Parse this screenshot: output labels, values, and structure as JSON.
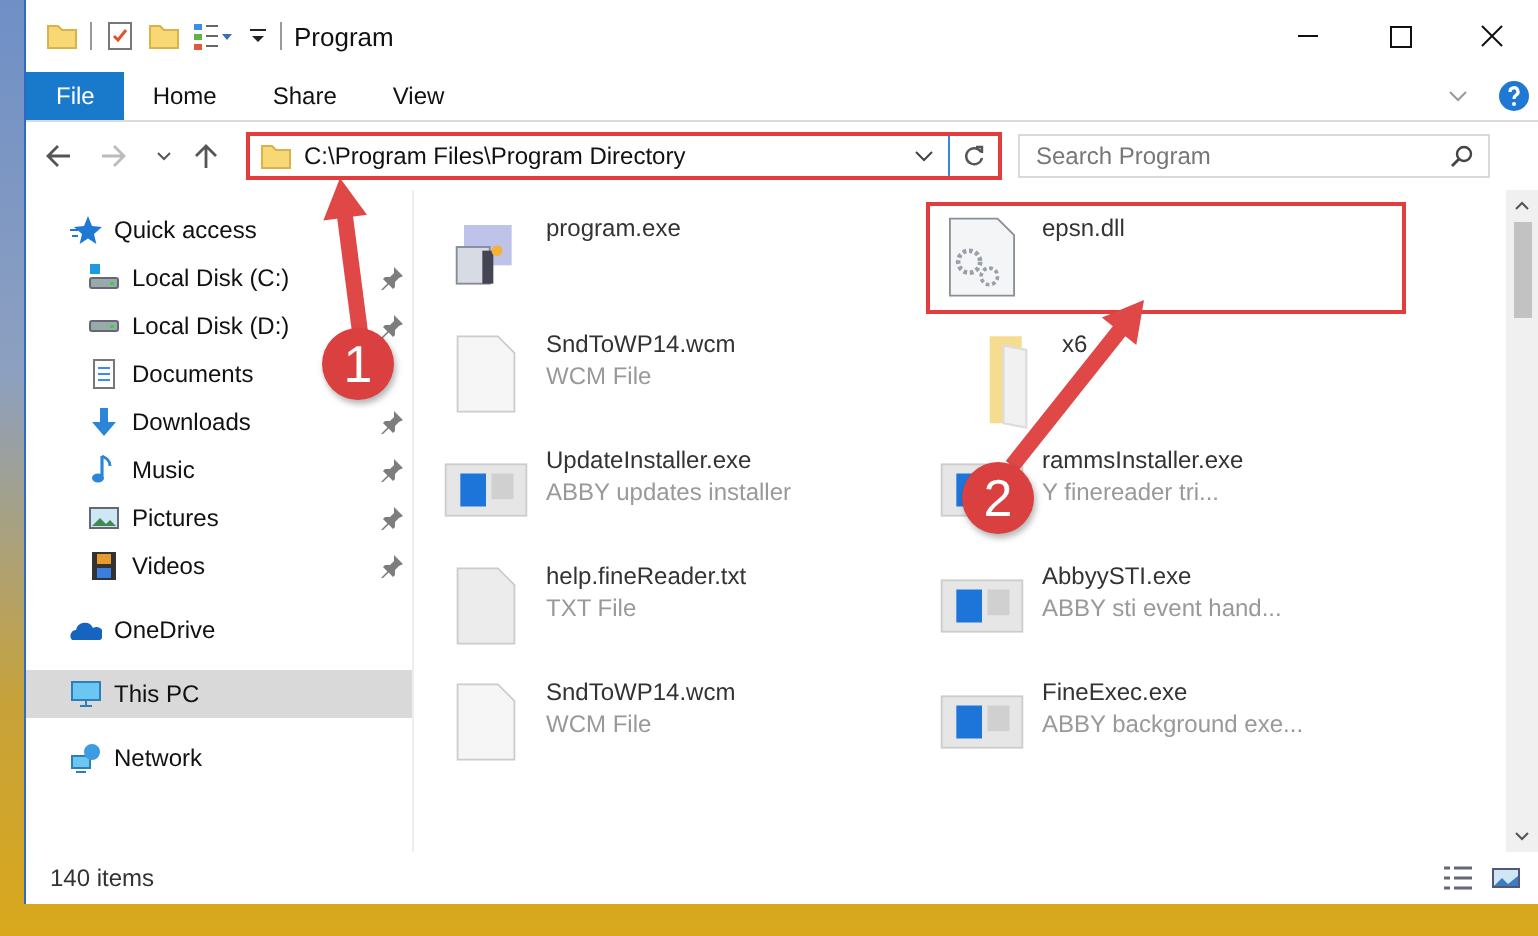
{
  "window": {
    "title": "Program"
  },
  "ribbon": {
    "tabs": [
      {
        "label": "File",
        "kind": "file"
      },
      {
        "label": "Home",
        "kind": "tab"
      },
      {
        "label": "Share",
        "kind": "tab"
      },
      {
        "label": "View",
        "kind": "tab"
      }
    ]
  },
  "address": {
    "path": "C:\\Program Files\\Program Directory",
    "highlighted": true
  },
  "search": {
    "placeholder": "Search Program"
  },
  "sidebar": {
    "items": [
      {
        "label": "Quick access",
        "kind": "quick-access",
        "selected": false,
        "children": [
          {
            "label": "Local Disk (C:)",
            "kind": "drive-c",
            "pinned": true
          },
          {
            "label": "Local Disk (D:)",
            "kind": "drive",
            "pinned": true
          },
          {
            "label": "Documents",
            "kind": "documents",
            "pinned": false
          },
          {
            "label": "Downloads",
            "kind": "downloads",
            "pinned": true
          },
          {
            "label": "Music",
            "kind": "music",
            "pinned": true
          },
          {
            "label": "Pictures",
            "kind": "pictures",
            "pinned": true
          },
          {
            "label": "Videos",
            "kind": "videos",
            "pinned": true
          }
        ]
      },
      {
        "label": "OneDrive",
        "kind": "onedrive",
        "selected": false
      },
      {
        "label": "This PC",
        "kind": "pc",
        "selected": true
      },
      {
        "label": "Network",
        "kind": "network",
        "selected": false
      }
    ]
  },
  "files": [
    {
      "name": "program.exe",
      "kind": "app",
      "highlighted": false
    },
    {
      "name": "epsn.dll",
      "kind": "dll",
      "highlighted": true
    },
    {
      "name": "SndToWP14.wcm",
      "type": "WCM File",
      "kind": "file",
      "highlighted": false
    },
    {
      "name": "x6",
      "kind": "folder",
      "highlighted": false
    },
    {
      "name": "UpdateInstaller.exe",
      "type": "ABBY updates installer",
      "kind": "window",
      "highlighted": false
    },
    {
      "name": "rammsInstaller.exe",
      "type": "Y finereader tri...",
      "kind": "window",
      "highlighted": false
    },
    {
      "name": "help.fineReader.txt",
      "type": "TXT File",
      "kind": "text",
      "highlighted": false
    },
    {
      "name": "AbbyySTI.exe",
      "type": "ABBY sti event hand...",
      "kind": "window",
      "highlighted": false
    },
    {
      "name": "SndToWP14.wcm",
      "type": "WCM File",
      "kind": "file",
      "highlighted": false
    },
    {
      "name": "FineExec.exe",
      "type": "ABBY background exe...",
      "kind": "window",
      "highlighted": false
    }
  ],
  "status_bar": {
    "count": "140 items"
  },
  "annotations": [
    {
      "label": "1"
    },
    {
      "label": "2"
    }
  ]
}
